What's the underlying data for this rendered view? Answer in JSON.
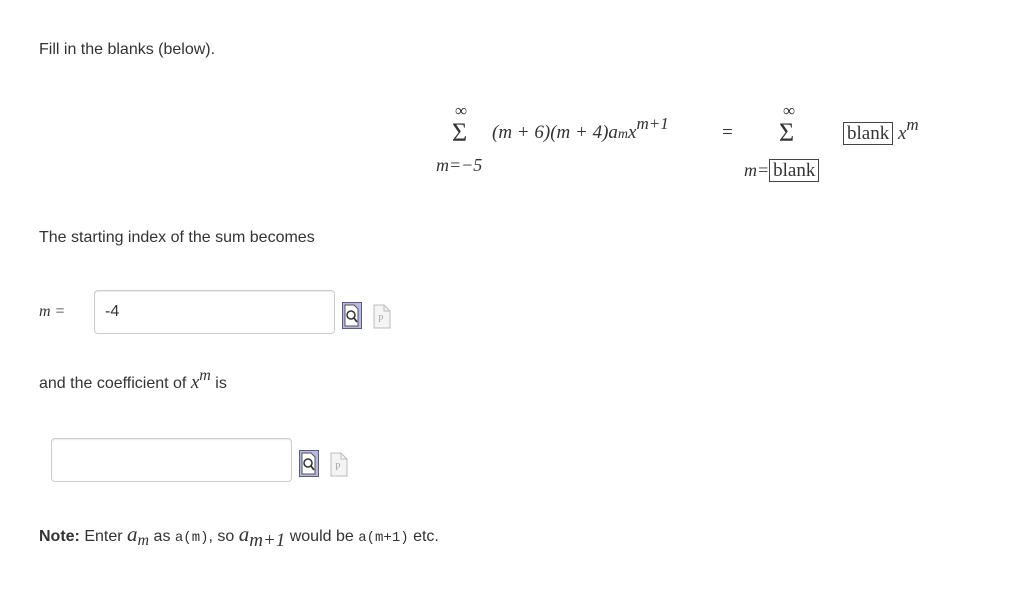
{
  "instruction": "Fill in the blanks (below).",
  "equation": {
    "sum_upper": "∞",
    "sum_symbol": "Σ",
    "left_lower": "m=−5",
    "left_term": "(m + 6)(m + 4)a",
    "left_sub": "m",
    "left_x": "x",
    "left_exp": "m+1",
    "equals": "=",
    "right_lower_prefix": "m=",
    "blank_label": "blank",
    "right_x": "x",
    "right_exp": "m"
  },
  "q1": {
    "text": "The starting index of the sum becomes",
    "label": "m =",
    "value": "-4"
  },
  "q2": {
    "text_before": "and the coefficient of ",
    "x": "x",
    "exp": "m",
    "text_after": " is",
    "value": ""
  },
  "note": {
    "bold": "Note:",
    "enter": " Enter ",
    "a": "a",
    "m": "m",
    "as": " as ",
    "code1": "a(m)",
    "so": ", so ",
    "a2": "a",
    "m1": "m+1",
    "would": " would be ",
    "code2": "a(m+1)",
    "etc": " etc."
  },
  "icons": [
    "preview-icon",
    "equation-editor-icon"
  ]
}
